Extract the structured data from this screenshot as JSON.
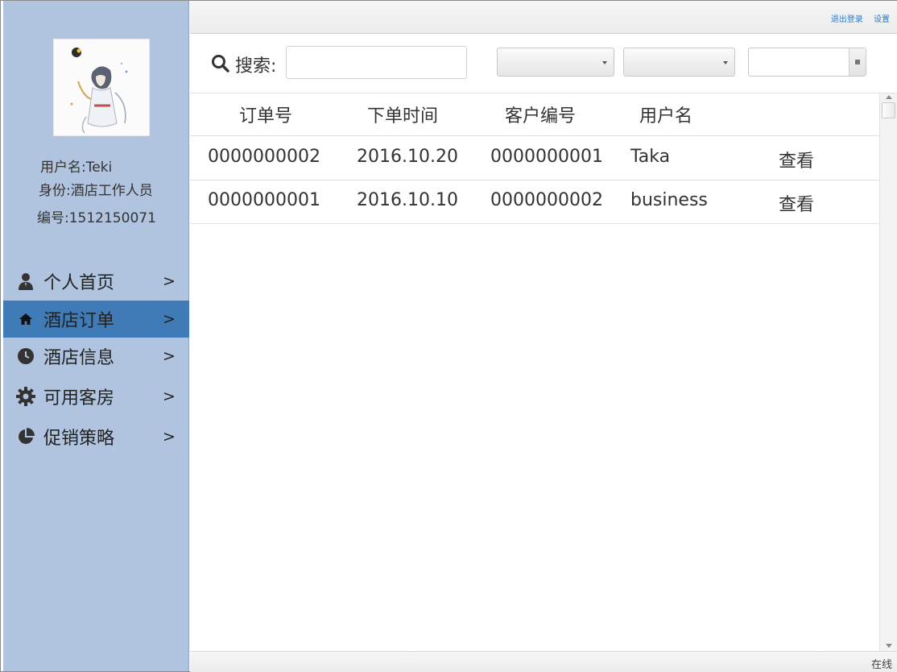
{
  "top_links": {
    "logout": "退出登录",
    "settings": "设置"
  },
  "profile": {
    "username_line": "用户名:Teki",
    "role_line": "身份:酒店工作人员",
    "id_line": "编号:1512150071"
  },
  "nav": {
    "arrow": ">",
    "items": [
      {
        "label": "个人首页",
        "icon": "user-icon",
        "active": false
      },
      {
        "label": "酒店订单",
        "icon": "home-icon",
        "active": true
      },
      {
        "label": "酒店信息",
        "icon": "clock-icon",
        "active": false
      },
      {
        "label": "可用客房",
        "icon": "gear-icon",
        "active": false
      },
      {
        "label": "促销策略",
        "icon": "pie-chart-icon",
        "active": false
      }
    ]
  },
  "search": {
    "label": "搜索:",
    "value": "",
    "placeholder": ""
  },
  "filters": {
    "select1": "",
    "select2": "",
    "date": ""
  },
  "table": {
    "columns": [
      "订单号",
      "下单时间",
      "客户编号",
      "用户名"
    ],
    "rows": [
      {
        "order_id": "0000000002",
        "time": "2016.10.20",
        "customer_id": "0000000001",
        "username": "Taka",
        "action": "查看"
      },
      {
        "order_id": "0000000001",
        "time": "2016.10.10",
        "customer_id": "0000000002",
        "username": "business",
        "action": "查看"
      }
    ]
  },
  "status": {
    "text": "在线"
  },
  "colors": {
    "sidebar_bg": "#b0c4df",
    "active_item": "#3f7bb6",
    "link": "#2e7cc4"
  }
}
